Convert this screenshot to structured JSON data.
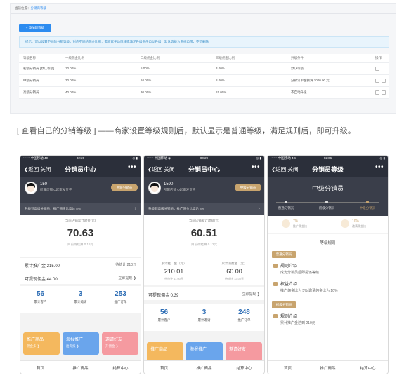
{
  "admin": {
    "crumb_label": "当前位置：",
    "crumb_link": "分销商等级",
    "add_button": "+ 添加新等级",
    "tip": "提示：可以设置不同的分销等级，对应不同的佣金比例；需商家手动审核或满足升级条件自动升级；默认等级为系统自带，不可删除",
    "columns": [
      "等级名称",
      "一级佣金比例",
      "二级佣金比例",
      "三级佣金比例",
      "升级条件",
      "操作"
    ],
    "rows": [
      {
        "name": "初级分销员 [默认等级]",
        "l1": "10.00%",
        "l2": "5.00%",
        "l3": "3.00%",
        "cond": "默认等级"
      },
      {
        "name": "中级分销员",
        "l1": "30.00%",
        "l2": "10.00%",
        "l3": "8.00%",
        "cond": "分销订单金额满 1000.00 元"
      },
      {
        "name": "高级分销员",
        "l1": "40.00%",
        "l2": "30.00%",
        "l3": "15.00%",
        "cond": "不自动升级"
      }
    ]
  },
  "caption": "[ 查看自己的分销等级 ] ——商家设置等级规则后，默认显示是普通等级，满足规则后，即可升级。",
  "phone1": {
    "status_left": "•••••• 中国移动  4G",
    "status_time": "02:26",
    "status_right": "◎ ▮",
    "back": "❮返回  关闭",
    "title": "分销员中心",
    "more": "•••",
    "user_id": "150",
    "shop": "所属店铺 Q起家发货子",
    "level_btn": "中级分销员",
    "upgrade": "升级到高级分销员，推广佣金比高达 8%",
    "earn_label": "当前店铺累计收益(元)",
    "earn_value": "70.63",
    "earn_sub": "目前待结算 0.16元",
    "row1_l": "累计推广金 215.00",
    "row1_r": "待统计 210元",
    "row2_l": "可提现佣金 44.00",
    "row2_r": "立即提现 ❯",
    "stats": [
      {
        "n": "56",
        "t": "累计客户"
      },
      {
        "n": "3",
        "t": "累计邀请"
      },
      {
        "n": "253",
        "t": "推广订单"
      }
    ],
    "cards": [
      {
        "t": "推广商品",
        "s": "佣金多 ❯"
      },
      {
        "t": "海报推广",
        "s": "出海报 ❯"
      },
      {
        "t": "邀请好友",
        "s": "升佣金 ❯"
      }
    ],
    "tabs": [
      "首页",
      "推广商品",
      "结算中心"
    ]
  },
  "phone2": {
    "status_left": "•••••• 中国移动  ◉",
    "status_time": "00:29",
    "status_right": "◎ ▮",
    "back": "❮返回  关闭",
    "title": "分销员中心",
    "more": "•••",
    "user_id": "1590",
    "shop": "所属店铺 Q起家发货子",
    "level_btn": "中级分销员",
    "upgrade": "升级到高级分销员，推广佣金比高达 8%",
    "earn_label": "当前店铺累计收益(元)",
    "earn_value": "60.51",
    "earn_sub": "目前待结算 0.12元",
    "c1_label": "累计推广金（元）",
    "c1_value": "210.01",
    "c1_sub": "待统计 11.00元",
    "c2_label": "累计消费金（元）",
    "c2_value": "60.00",
    "c2_sub": "待统计 12.00元",
    "row_l": "可提现佣金 0.39",
    "row_r": "立即提现 ❯",
    "stats": [
      {
        "n": "56",
        "t": "累计客户"
      },
      {
        "n": "3",
        "t": "累计邀请"
      },
      {
        "n": "248",
        "t": "推广订单"
      }
    ],
    "cards": [
      {
        "t": "推广商品",
        "s": ""
      },
      {
        "t": "海报推广",
        "s": ""
      },
      {
        "t": "邀请好友",
        "s": ""
      }
    ],
    "tabs": [
      "首页",
      "推广商品",
      "结算中心"
    ]
  },
  "phone3": {
    "status_left": "•••••• 中国移动  4G",
    "status_time": "02:06",
    "status_right": "◎ ▮",
    "back": "❮返回  关闭",
    "title": "分销员等级",
    "more": "•••",
    "level_title": "中级分销员",
    "levels": [
      "普通分销员",
      "初级分销员",
      "中级分销员"
    ],
    "rate1_pct": "7%",
    "rate1_name": "推广佣金比",
    "rate2_pct": "10%",
    "rate2_name": "邀请佣金比",
    "rules_head": "等级规则",
    "tag1": "普通分销员",
    "rule1_title": "规则介绍",
    "rule1_text": "成为分销员后即是该等级",
    "rule2_title": "权益介绍",
    "rule2_text": "推广佣金比为 5%   邀请佣金比为 10%",
    "tag2": "初级分销员",
    "rule3_title": "规则介绍",
    "rule3_text": "累计推广金达到 210元",
    "tabs": [
      "首页",
      "推广商品",
      "结算中心"
    ]
  }
}
